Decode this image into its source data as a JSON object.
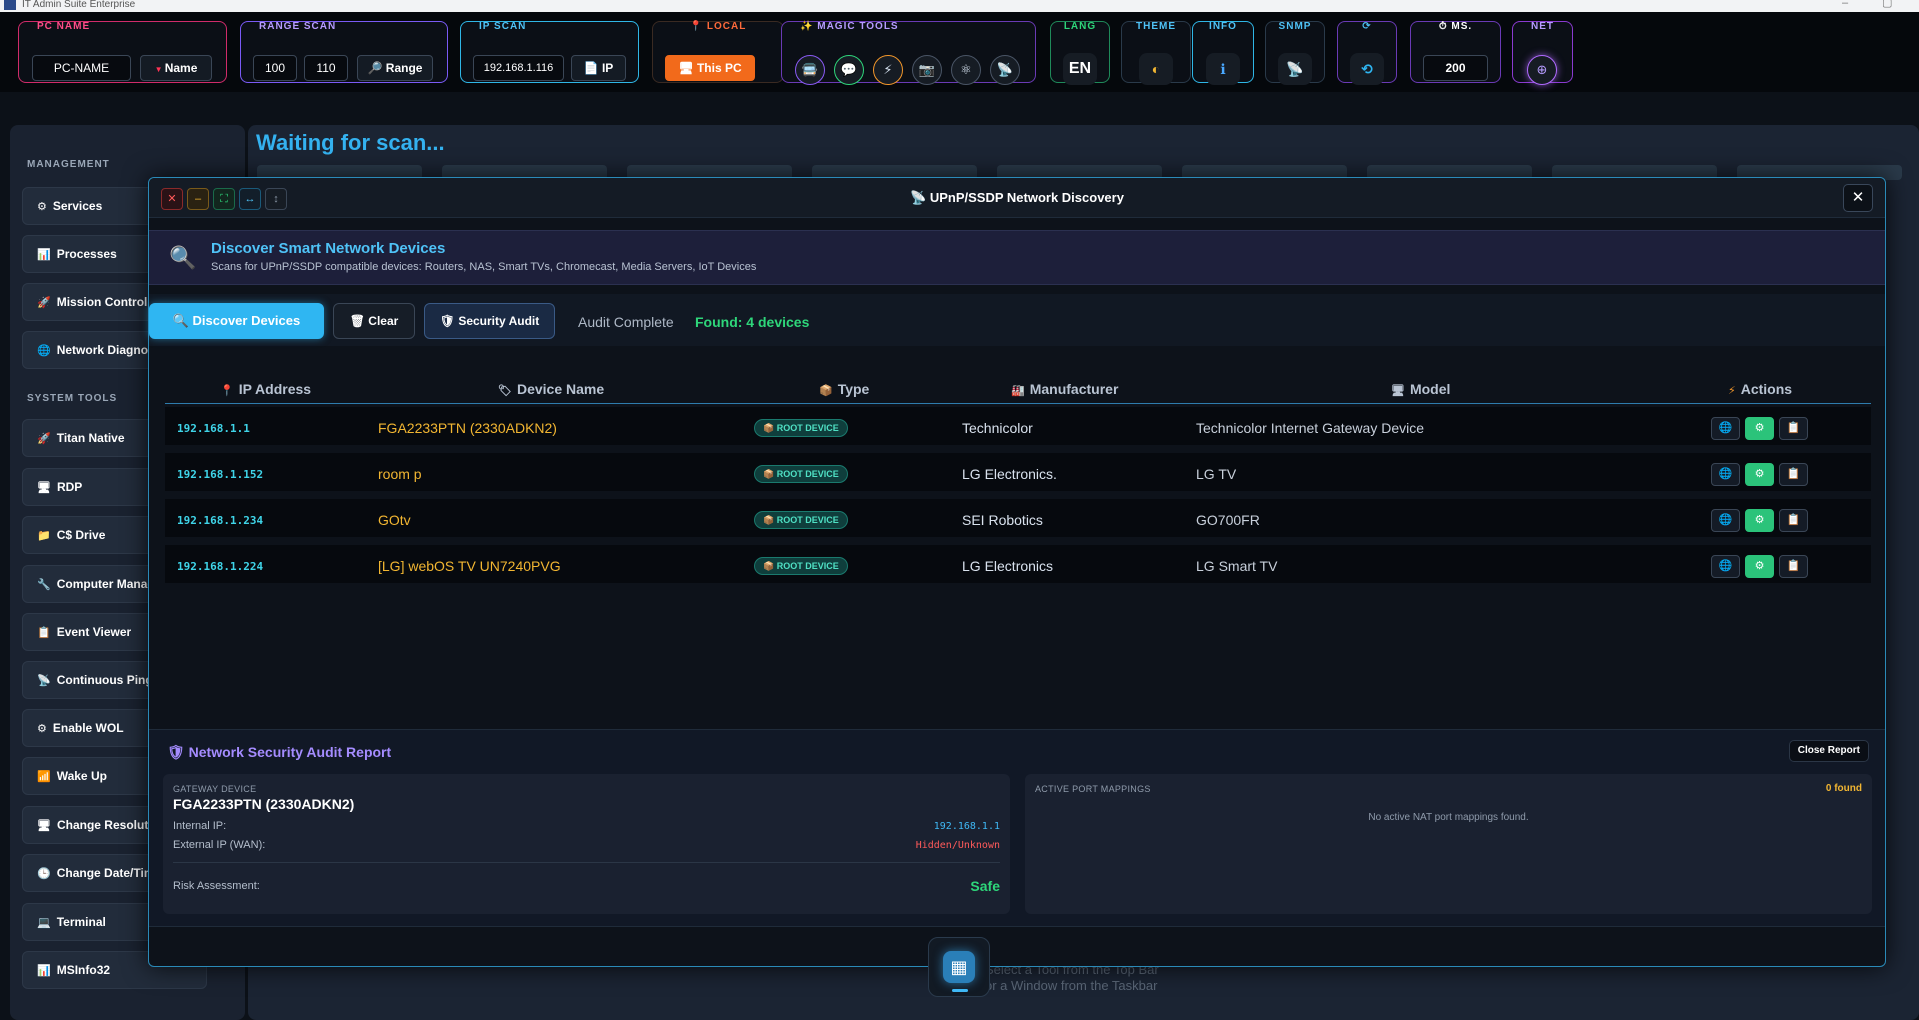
{
  "window": {
    "title": "IT Admin Suite Enterprise"
  },
  "topbar": {
    "pc_name": {
      "label": "PC NAME",
      "value": "PC-NAME",
      "button": "Name"
    },
    "range_scan": {
      "label": "RANGE SCAN",
      "from": "100",
      "to": "110",
      "button": "Range"
    },
    "ip_scan": {
      "label": "IP SCAN",
      "value": "192.168.1.116",
      "button": "IP"
    },
    "local": {
      "label": "LOCAL",
      "button": "This PC"
    },
    "magic_tools": {
      "label": "MAGIC TOOLS",
      "icons": [
        "🚍",
        "💬",
        "⚡",
        "📷",
        "⚛",
        "📡"
      ]
    },
    "lang": {
      "label": "LANG",
      "value": "EN"
    },
    "theme": {
      "label": "THEME"
    },
    "info": {
      "label": "INFO"
    },
    "snmp": {
      "label": "SNMP"
    },
    "refresh_label": "⟳",
    "ms": {
      "label": "MS.",
      "value": "200"
    },
    "net": {
      "label": "NET"
    }
  },
  "sidebar": {
    "management_heading": "MANAGEMENT",
    "system_tools_heading": "SYSTEM TOOLS",
    "items": [
      {
        "icon": "⚙",
        "label": "Services"
      },
      {
        "icon": "📊",
        "label": "Processes"
      },
      {
        "icon": "🚀",
        "label": "Mission Control"
      },
      {
        "icon": "🌐",
        "label": "Network Diagnostics"
      },
      {
        "icon": "🚀",
        "label": "Titan Native"
      },
      {
        "icon": "🖥",
        "label": "RDP"
      },
      {
        "icon": "📁",
        "label": "C$ Drive"
      },
      {
        "icon": "🔧",
        "label": "Computer Management"
      },
      {
        "icon": "📋",
        "label": "Event Viewer"
      },
      {
        "icon": "📡",
        "label": "Continuous Ping"
      },
      {
        "icon": "⚙",
        "label": "Enable WOL"
      },
      {
        "icon": "📶",
        "label": "Wake Up"
      },
      {
        "icon": "🖥",
        "label": "Change Resolution"
      },
      {
        "icon": "🕒",
        "label": "Change Date/Time"
      },
      {
        "icon": "💻",
        "label": "Terminal"
      },
      {
        "icon": "📊",
        "label": "MSInfo32"
      }
    ]
  },
  "main": {
    "status": "Waiting for scan...",
    "hint1": "Select a Tool from the Top Bar",
    "hint2": "or a Window from the Taskbar"
  },
  "modal": {
    "title": "📡 UPnP/SSDP Network Discovery",
    "banner_title": "Discover Smart Network Devices",
    "banner_subtitle": "Scans for UPnP/SSDP compatible devices: Routers, NAS, Smart TVs, Chromecast, Media Servers, IoT Devices",
    "discover_button": "🔍 Discover Devices",
    "clear_button": "🗑 Clear",
    "audit_button": "🛡 Security Audit",
    "status": "Audit Complete",
    "found": "Found: 4 devices",
    "columns": [
      {
        "icon": "📍",
        "label": "IP Address"
      },
      {
        "icon": "🏷",
        "label": "Device Name"
      },
      {
        "icon": "📦",
        "label": "Type"
      },
      {
        "icon": "🏭",
        "label": "Manufacturer"
      },
      {
        "icon": "🖥",
        "label": "Model"
      },
      {
        "icon": "⚡",
        "label": "Actions"
      }
    ],
    "rows": [
      {
        "ip": "192.168.1.1",
        "name": "FGA2233PTN (2330ADKN2)",
        "type": "ROOT DEVICE",
        "manufacturer": "Technicolor",
        "model": "Technicolor Internet Gateway Device"
      },
      {
        "ip": "192.168.1.152",
        "name": "room p",
        "type": "ROOT DEVICE",
        "manufacturer": "LG Electronics.",
        "model": "LG TV"
      },
      {
        "ip": "192.168.1.234",
        "name": "GOtv",
        "type": "ROOT DEVICE",
        "manufacturer": "SEI Robotics",
        "model": "GO700FR"
      },
      {
        "ip": "192.168.1.224",
        "name": "[LG] webOS TV UN7240PVG",
        "type": "ROOT DEVICE",
        "manufacturer": "LG Electronics",
        "model": "LG Smart TV"
      }
    ],
    "row_action_icons": [
      "🌐",
      "⚙",
      "📋"
    ],
    "report": {
      "title": "🛡 Network Security Audit Report",
      "close": "Close Report",
      "gateway_label": "GATEWAY DEVICE",
      "gateway_name": "FGA2233PTN (2330ADKN2)",
      "internal_ip_label": "Internal IP:",
      "internal_ip": "192.168.1.1",
      "external_ip_label": "External IP (WAN):",
      "external_ip": "Hidden/Unknown",
      "risk_label": "Risk Assessment:",
      "risk_value": "Safe",
      "ports_label": "ACTIVE PORT MAPPINGS",
      "ports_count": "0 found",
      "ports_empty": "No active NAT port mappings found."
    }
  },
  "colors": {
    "accent": "#2fb6f2",
    "success": "#2ed67a",
    "warning": "#f2b632",
    "orange": "#f26a1b",
    "purple": "#a58cff"
  }
}
